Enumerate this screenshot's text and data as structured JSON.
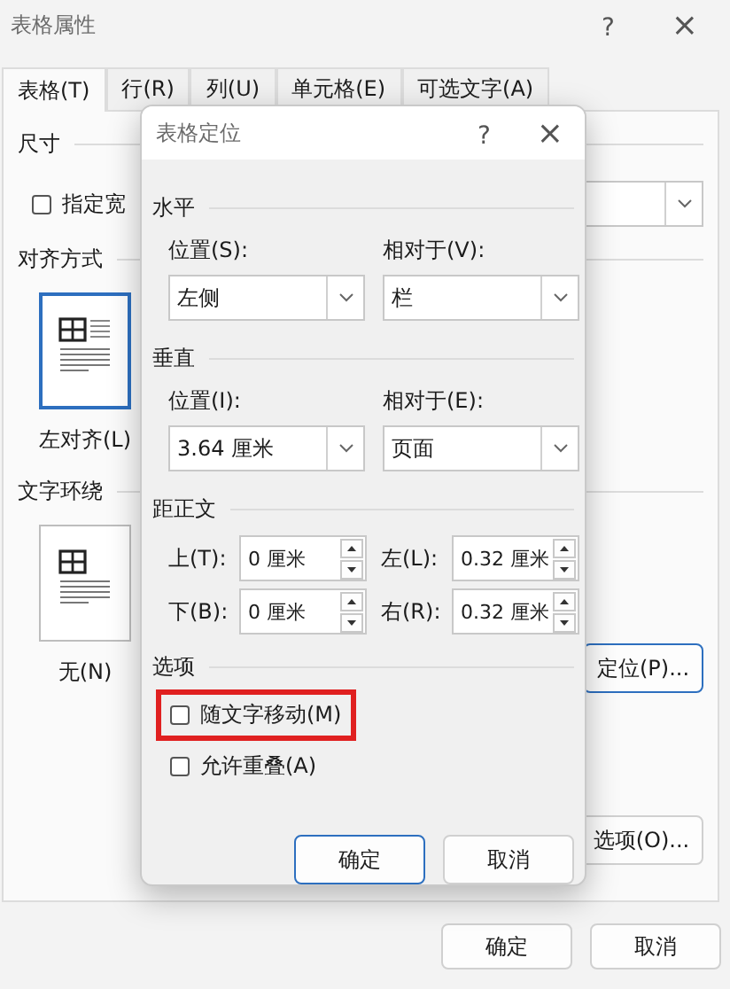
{
  "outer": {
    "title": "表格属性",
    "help": "?",
    "close": "×",
    "tabs": [
      {
        "label": "表格(T)",
        "selected": true
      },
      {
        "label": "行(R)",
        "selected": false
      },
      {
        "label": "列(U)",
        "selected": false
      },
      {
        "label": "单元格(E)",
        "selected": false
      },
      {
        "label": "可选文字(A)",
        "selected": false
      }
    ],
    "size": {
      "heading": "尺寸",
      "checkbox": {
        "label": "指定宽",
        "checked": false
      }
    },
    "alignment": {
      "heading": "对齐方式",
      "options": [
        {
          "label": "左对齐(L)",
          "selected": true
        }
      ]
    },
    "wrapping": {
      "heading": "文字环绕",
      "options": [
        {
          "label": "无(N)",
          "selected": false
        }
      ],
      "position_button": "定位(P)...",
      "options_button": "选项(O)..."
    },
    "buttons": [
      {
        "label": "确定",
        "default": false
      },
      {
        "label": "取消",
        "default": false
      }
    ]
  },
  "dialog": {
    "title": "表格定位",
    "help": "?",
    "close": "×",
    "horizontal": {
      "heading": "水平",
      "position": {
        "label": "位置(S):",
        "value": "左侧"
      },
      "relative_to": {
        "label": "相对于(V):",
        "value": "栏"
      }
    },
    "vertical": {
      "heading": "垂直",
      "position": {
        "label": "位置(I):",
        "value": "3.64 厘米"
      },
      "relative_to": {
        "label": "相对于(E):",
        "value": "页面"
      }
    },
    "distance": {
      "heading": "距正文",
      "fields": [
        {
          "label": "上(T):",
          "value": "0 厘米"
        },
        {
          "label": "左(L):",
          "value": "0.32 厘米"
        },
        {
          "label": "下(B):",
          "value": "0 厘米"
        },
        {
          "label": "右(R):",
          "value": "0.32 厘米"
        }
      ]
    },
    "options": {
      "heading": "选项",
      "items": [
        {
          "label": "随文字移动(M)",
          "checked": false,
          "highlighted": true
        },
        {
          "label": "允许重叠(A)",
          "checked": false,
          "highlighted": false
        }
      ]
    },
    "buttons": [
      {
        "label": "确定",
        "default": true
      },
      {
        "label": "取消",
        "default": false
      }
    ]
  }
}
